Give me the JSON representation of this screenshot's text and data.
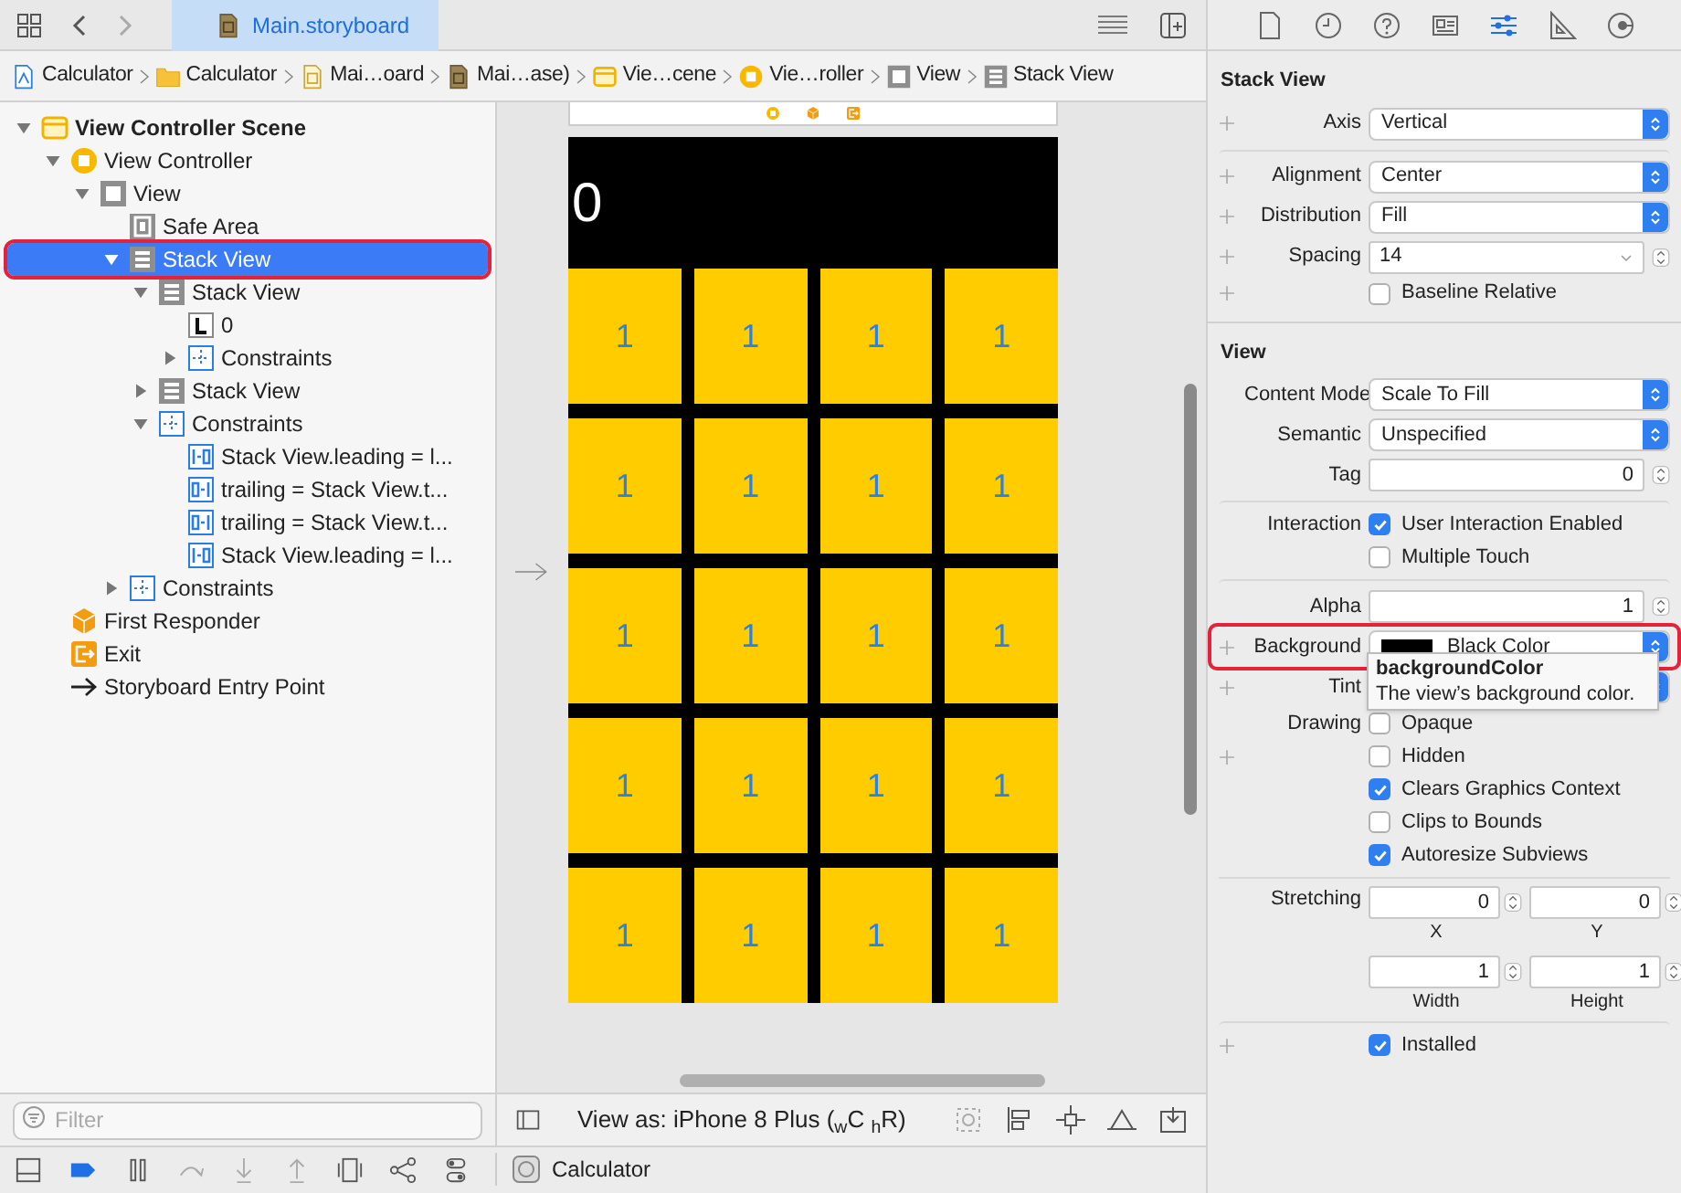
{
  "toolbar": {
    "tab": {
      "label": "Main.storyboard",
      "selected": true
    }
  },
  "breadcrumb": [
    {
      "kind": "project",
      "label": "Calculator"
    },
    {
      "kind": "folder",
      "label": "Calculator"
    },
    {
      "kind": "file",
      "label": "Mai…oard"
    },
    {
      "kind": "storyboard",
      "label": "Mai…ase)"
    },
    {
      "kind": "scene",
      "label": "Vie…cene"
    },
    {
      "kind": "vc",
      "label": "Vie…roller"
    },
    {
      "kind": "view",
      "label": "View"
    },
    {
      "kind": "stack",
      "label": "Stack View"
    }
  ],
  "outline": [
    {
      "kind": "scene",
      "label": "View Controller Scene",
      "expanded": true,
      "selected": false,
      "children": [
        {
          "kind": "vc",
          "label": "View Controller",
          "expanded": true,
          "selected": false,
          "children": [
            {
              "kind": "view",
              "label": "View",
              "expanded": true,
              "selected": false,
              "children": [
                {
                  "kind": "safearea",
                  "label": "Safe Area",
                  "selected": false
                },
                {
                  "kind": "stack",
                  "label": "Stack View",
                  "expanded": true,
                  "selected": true,
                  "highlighted": true,
                  "children": [
                    {
                      "kind": "stack",
                      "label": "Stack View",
                      "expanded": true,
                      "selected": false,
                      "children": [
                        {
                          "kind": "label",
                          "label": "0",
                          "selected": false
                        },
                        {
                          "kind": "constraints",
                          "label": "Constraints",
                          "expanded": false,
                          "selected": false
                        }
                      ]
                    },
                    {
                      "kind": "stack",
                      "label": "Stack View",
                      "expanded": false,
                      "selected": false
                    },
                    {
                      "kind": "constraints",
                      "label": "Constraints",
                      "expanded": true,
                      "selected": false,
                      "children": [
                        {
                          "kind": "leading",
                          "label": "Stack View.leading = l...",
                          "selected": false
                        },
                        {
                          "kind": "trailing",
                          "label": "trailing = Stack View.t...",
                          "selected": false
                        },
                        {
                          "kind": "trailing",
                          "label": "trailing = Stack View.t...",
                          "selected": false
                        },
                        {
                          "kind": "leading",
                          "label": "Stack View.leading = l...",
                          "selected": false
                        }
                      ]
                    }
                  ]
                },
                {
                  "kind": "constraints",
                  "label": "Constraints",
                  "expanded": false,
                  "selected": false
                }
              ]
            }
          ]
        },
        {
          "kind": "responder",
          "label": "First Responder",
          "selected": false
        },
        {
          "kind": "exit",
          "label": "Exit",
          "selected": false
        },
        {
          "kind": "entry",
          "label": "Storyboard Entry Point",
          "selected": false
        }
      ]
    }
  ],
  "filter": {
    "placeholder": "Filter"
  },
  "canvas": {
    "display": "0",
    "keys": [
      "1",
      "1",
      "1",
      "1",
      "1",
      "1",
      "1",
      "1",
      "1",
      "1",
      "1",
      "1",
      "1",
      "1",
      "1",
      "1",
      "1",
      "1",
      "1",
      "1"
    ]
  },
  "view_as": "View as: iPhone 8 Plus ($_{w}$C $_{h}$R)",
  "debug_bar": {
    "breakpoints_active": true,
    "target": "Calculator"
  },
  "inspector": {
    "tabs": [
      {
        "kind": "file",
        "selected": false
      },
      {
        "kind": "history",
        "selected": false
      },
      {
        "kind": "help",
        "selected": false
      },
      {
        "kind": "identity",
        "selected": false
      },
      {
        "kind": "attributes",
        "selected": true
      },
      {
        "kind": "size",
        "selected": false
      },
      {
        "kind": "connections",
        "selected": false
      }
    ],
    "sections": [
      {
        "title": "Stack View",
        "rows": [
          {
            "kind": "popup",
            "plus": true,
            "label": "Axis",
            "value": "Vertical"
          },
          {
            "kind": "popup",
            "plus": true,
            "separator_before": true,
            "label": "Alignment",
            "value": "Center"
          },
          {
            "kind": "popup",
            "plus": true,
            "label": "Distribution",
            "value": "Fill"
          },
          {
            "kind": "combo",
            "plus": true,
            "label": "Spacing",
            "value": "14"
          },
          {
            "kind": "checkbox",
            "plus": true,
            "text": "Baseline Relative",
            "checked": false
          }
        ]
      },
      {
        "title": "View",
        "rows": [
          {
            "kind": "popup",
            "label": "Content Mode",
            "value": "Scale To Fill"
          },
          {
            "kind": "popup",
            "label": "Semantic",
            "value": "Unspecified"
          },
          {
            "kind": "number",
            "label": "Tag",
            "value": "0"
          },
          {
            "kind": "checkbox",
            "separator_before": true,
            "label": "Interaction",
            "text": "User Interaction Enabled",
            "checked": true
          },
          {
            "kind": "checkbox",
            "text": "Multiple Touch",
            "checked": false
          },
          {
            "kind": "number",
            "separator_before": true,
            "label": "Alpha",
            "value": "1"
          },
          {
            "kind": "color",
            "plus": true,
            "highlighted": true,
            "label": "Background",
            "value": "Black Color",
            "color": "#000000"
          },
          {
            "kind": "popup",
            "plus": true,
            "label": "Tint"
          },
          {
            "kind": "checkbox",
            "label": "Drawing",
            "text": "Opaque",
            "checked": false
          },
          {
            "kind": "checkbox",
            "plus": true,
            "text": "Hidden",
            "checked": false
          },
          {
            "kind": "checkbox",
            "text": "Clears Graphics Context",
            "checked": true
          },
          {
            "kind": "checkbox",
            "text": "Clips to Bounds",
            "checked": false
          },
          {
            "kind": "checkbox",
            "text": "Autoresize Subviews",
            "checked": true
          },
          {
            "kind": "pair",
            "separator_before": true,
            "label": "Stretching",
            "fields": [
              {
                "value": "0",
                "caption": "X"
              },
              {
                "value": "0",
                "caption": "Y"
              }
            ]
          },
          {
            "kind": "pair",
            "fields": [
              {
                "value": "1",
                "caption": "Width"
              },
              {
                "value": "1",
                "caption": "Height"
              }
            ]
          },
          {
            "kind": "checkbox",
            "plus": true,
            "separator_before": true,
            "text": "Installed",
            "checked": true
          }
        ]
      }
    ],
    "tooltip": {
      "title": "backgroundColor",
      "text": "The view’s background color."
    }
  }
}
